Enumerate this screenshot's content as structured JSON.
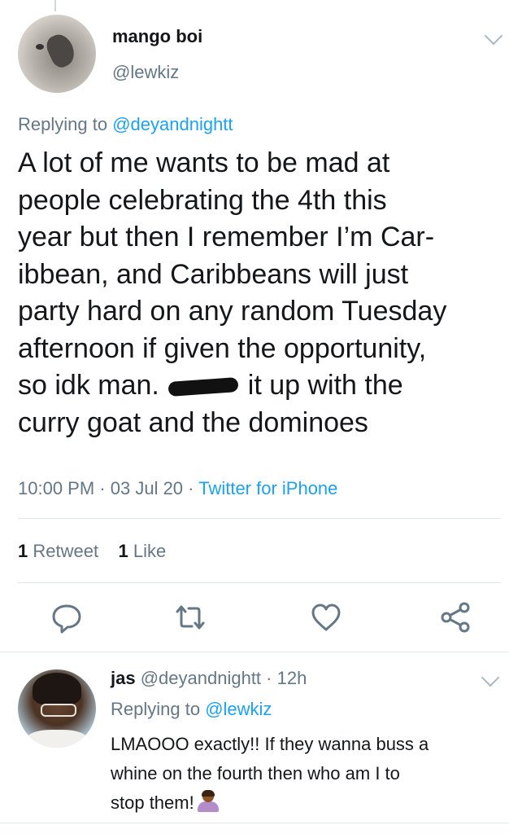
{
  "main_tweet": {
    "display_name": "mango boi",
    "handle": "@lewkiz",
    "replying_prefix": "Replying to",
    "replying_to": "@deyandnightt",
    "text_lines": [
      "A lot of me wants to be mad at",
      "people celebrating the 4th this",
      "year but then I remember I’m Car-",
      "ibbean, and Caribbeans will just",
      "party hard on any random Tuesday",
      "afternoon if given the opportunity,"
    ],
    "text_line7_before": "so idk man.",
    "text_line7_after": "it up with the",
    "text_line8": "curry goat and the dominoes",
    "time": "10:00 PM",
    "date": "03 Jul 20",
    "source": "Twitter for iPhone",
    "separator": "·",
    "retweet_count": "1",
    "retweet_label": "Retweet",
    "like_count": "1",
    "like_label": "Like",
    "actions": [
      "reply-icon",
      "retweet-icon",
      "heart-icon",
      "share-icon"
    ]
  },
  "reply_tweet": {
    "display_name": "jas",
    "handle": "@deyandnightt",
    "separator": "·",
    "time_ago": "12h",
    "replying_prefix": "Replying to",
    "replying_to": "@lewkiz",
    "text_lines": [
      "LMAOOO exactly!! If they wanna buss a",
      "whine on the fourth then who am I to"
    ],
    "text_line3": "stop them!",
    "emoji": "woman-shrugging-emoji"
  },
  "colors": {
    "text": "#14171a",
    "secondary": "#657786",
    "link": "#1da1f2",
    "divider": "#e1e8ed",
    "icon": "#657786"
  }
}
